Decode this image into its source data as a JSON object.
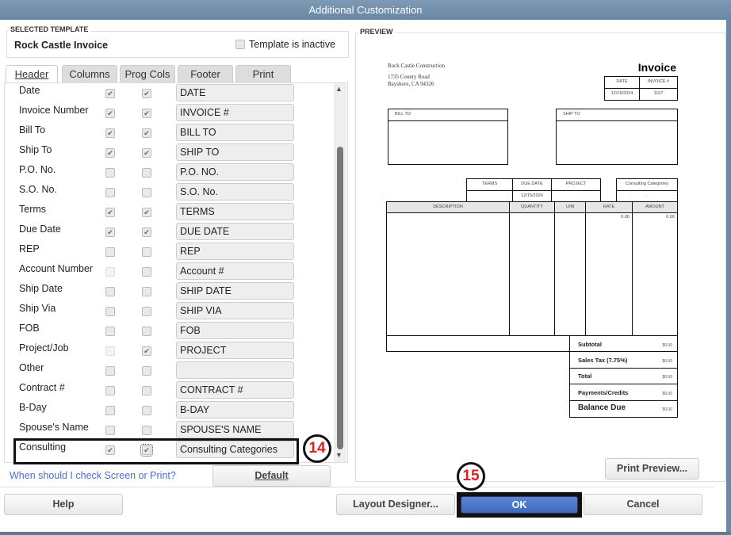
{
  "window": {
    "title": "Additional Customization"
  },
  "selected_template": {
    "group_label": "SELECTED TEMPLATE",
    "name": "Rock Castle Invoice",
    "inactive_label": "Template is inactive",
    "inactive_checked": false
  },
  "tabs": [
    {
      "label": "Header",
      "active": true
    },
    {
      "label": "Columns"
    },
    {
      "label": "Prog Cols"
    },
    {
      "label": "Footer"
    },
    {
      "label": "Print"
    }
  ],
  "rows": [
    {
      "label": "Date",
      "screen": true,
      "print": true,
      "title": "DATE"
    },
    {
      "label": "Invoice Number",
      "screen": true,
      "print": true,
      "title": "INVOICE #"
    },
    {
      "label": "Bill To",
      "screen": true,
      "print": true,
      "title": "BILL TO"
    },
    {
      "label": "Ship To",
      "screen": true,
      "print": true,
      "title": "SHIP TO"
    },
    {
      "label": "P.O. No.",
      "screen": false,
      "print": false,
      "title": "P.O. NO."
    },
    {
      "label": "S.O. No.",
      "screen": false,
      "print": false,
      "title": "S.O. No."
    },
    {
      "label": "Terms",
      "screen": true,
      "print": true,
      "title": "TERMS"
    },
    {
      "label": "Due Date",
      "screen": true,
      "print": true,
      "title": "DUE DATE"
    },
    {
      "label": "REP",
      "screen": false,
      "print": false,
      "title": "REP"
    },
    {
      "label": "Account Number",
      "screen": false,
      "print": false,
      "title": "Account #",
      "screen_disabled": true
    },
    {
      "label": "Ship Date",
      "screen": false,
      "print": false,
      "title": "SHIP DATE"
    },
    {
      "label": "Ship Via",
      "screen": false,
      "print": false,
      "title": "SHIP VIA"
    },
    {
      "label": "FOB",
      "screen": false,
      "print": false,
      "title": "FOB"
    },
    {
      "label": "Project/Job",
      "screen": false,
      "print": true,
      "title": "PROJECT",
      "screen_disabled": true
    },
    {
      "label": "Other",
      "screen": false,
      "print": false,
      "title": ""
    },
    {
      "label": "Contract #",
      "screen": false,
      "print": false,
      "title": "CONTRACT #"
    },
    {
      "label": "B-Day",
      "screen": false,
      "print": false,
      "title": "B-DAY"
    },
    {
      "label": "Spouse's Name",
      "screen": false,
      "print": false,
      "title": "SPOUSE'S NAME"
    },
    {
      "label": "Consulting",
      "screen": true,
      "print": true,
      "title": "Consulting Categories",
      "focused": true
    }
  ],
  "help_link": "When should I check Screen or Print?",
  "default_button": "Default",
  "preview": {
    "group_label": "PREVIEW",
    "company": "Rock Castle Construction",
    "address1": "1735 County Road",
    "address2": "Bayshore, CA 94326",
    "doc_title": "Invoice",
    "date_h": "DATE",
    "invoice_h": "INVOICE #",
    "date_v": "12/15/2024",
    "invoice_v": "1107",
    "bill_to": "BILL TO",
    "ship_to": "SHIP TO",
    "terms_h": "TERMS",
    "due_h": "DUE DATE",
    "project_h": "PROJECT",
    "due_v": "12/15/2024",
    "consult_h": "Consulting Categories",
    "consult_v": ".",
    "cols": [
      "DESCRIPTION",
      "QUANTITY",
      "U/M",
      "RATE",
      "AMOUNT"
    ],
    "rate_v": "0.00",
    "amount_v": "0.00",
    "totals": [
      {
        "label": "Subtotal",
        "value": "$0.00"
      },
      {
        "label": "Sales Tax  (7.75%)",
        "value": "$0.00"
      },
      {
        "label": "Total",
        "value": "$0.00"
      },
      {
        "label": "Payments/Credits",
        "value": "$0.00"
      },
      {
        "label": "Balance Due",
        "value": "$0.00"
      }
    ],
    "print_preview_button": "Print Preview..."
  },
  "buttons": {
    "help": "Help",
    "layout_designer": "Layout Designer...",
    "ok": "OK",
    "cancel": "Cancel"
  },
  "annotations": {
    "step14": "14",
    "step15": "15"
  },
  "colors": {
    "ok": "#4a75c4",
    "link": "#4a6fd0",
    "annotation": "#e0201c"
  }
}
